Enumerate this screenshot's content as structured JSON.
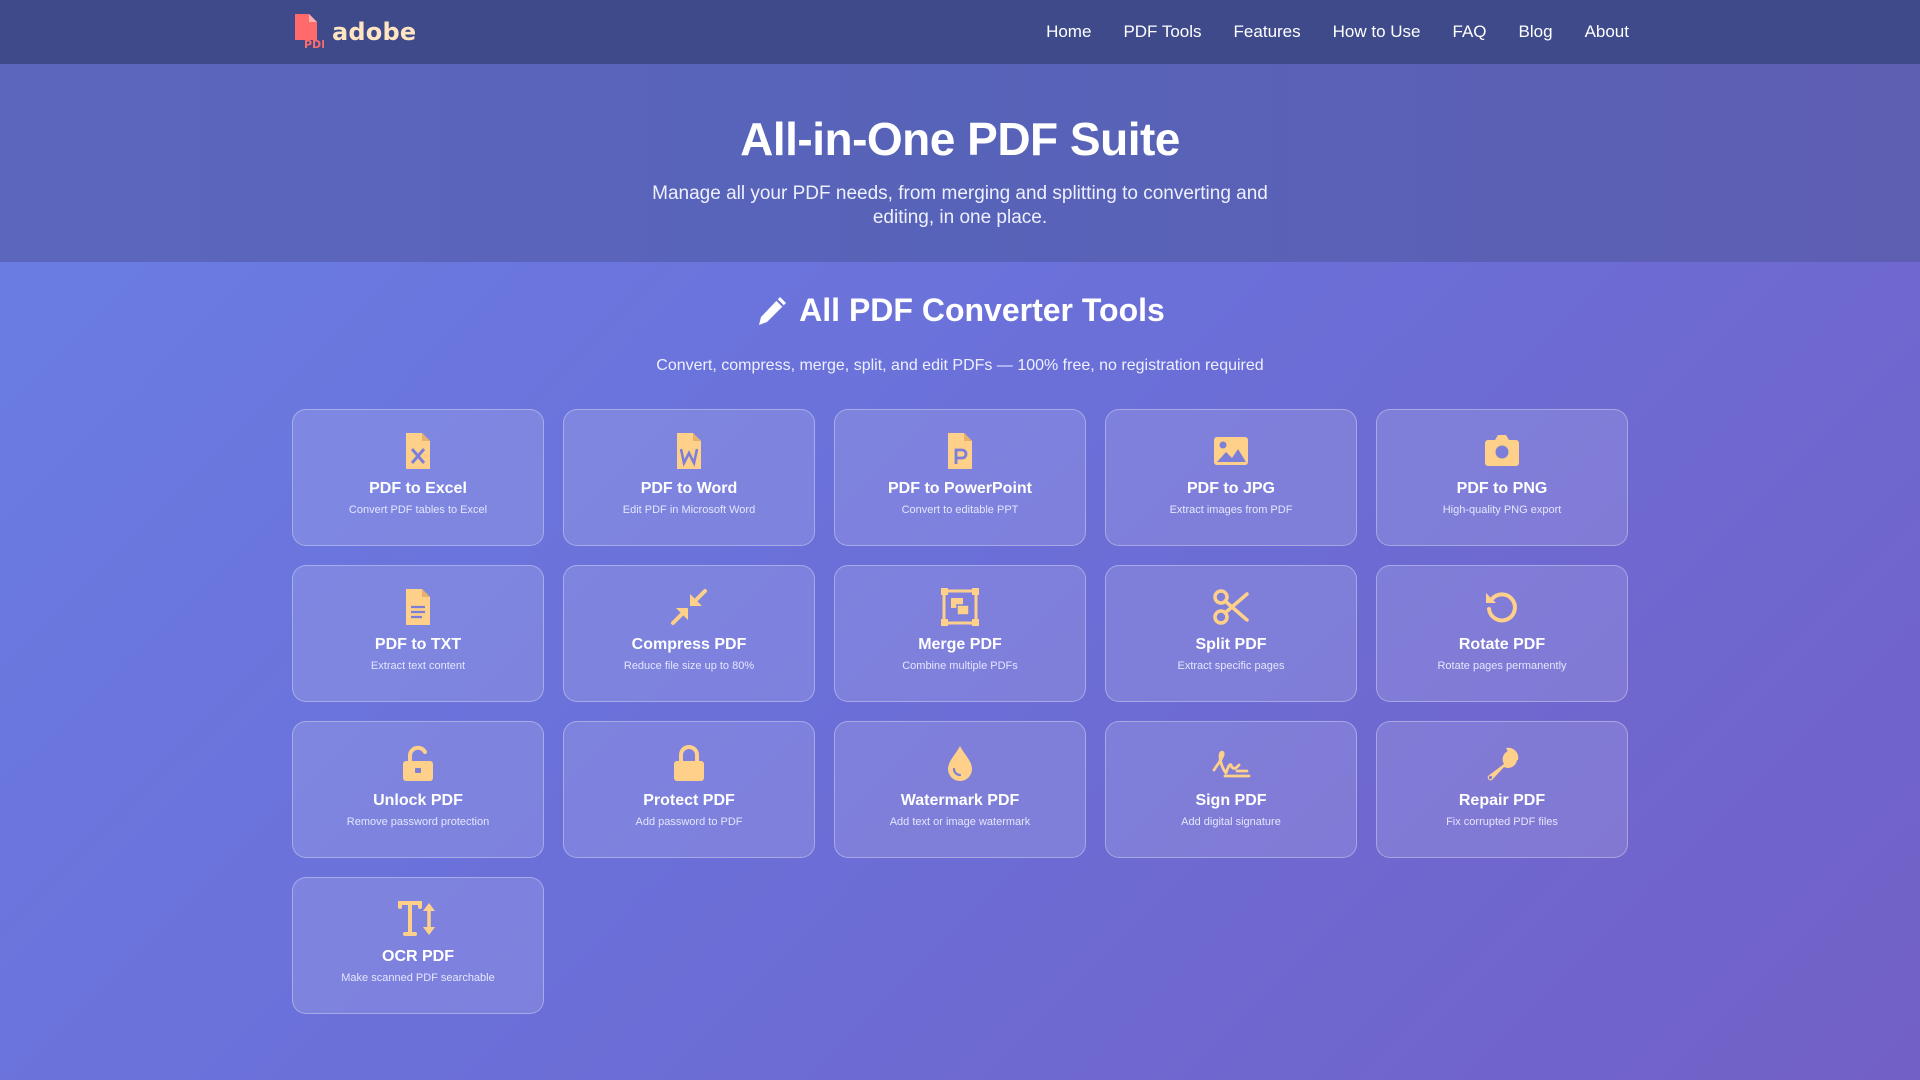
{
  "nav": {
    "brand": "adobe",
    "brand_badge": "PDF",
    "links": [
      "Home",
      "PDF Tools",
      "Features",
      "How to Use",
      "FAQ",
      "Blog",
      "About"
    ]
  },
  "hero": {
    "title": "All-in-One PDF Suite",
    "subtitle": "Manage all your PDF needs, from merging and splitting to converting and editing, in one place."
  },
  "section": {
    "title": "All PDF Converter Tools",
    "subtitle": "Convert, compress, merge, split, and edit PDFs — 100% free, no registration required"
  },
  "colors": {
    "accent_icon": "#ffd08a",
    "brand_red": "#ff6b6b",
    "brand_text": "#ffe5c2",
    "navbar": "#3e4a8a"
  },
  "tools": [
    {
      "title": "PDF to Excel",
      "desc": "Convert PDF tables to Excel",
      "icon": "file-excel-icon"
    },
    {
      "title": "PDF to Word",
      "desc": "Edit PDF in Microsoft Word",
      "icon": "file-word-icon"
    },
    {
      "title": "PDF to PowerPoint",
      "desc": "Convert to editable PPT",
      "icon": "file-powerpoint-icon"
    },
    {
      "title": "PDF to JPG",
      "desc": "Extract images from PDF",
      "icon": "image-icon"
    },
    {
      "title": "PDF to PNG",
      "desc": "High-quality PNG export",
      "icon": "camera-icon"
    },
    {
      "title": "PDF to TXT",
      "desc": "Extract text content",
      "icon": "file-text-icon"
    },
    {
      "title": "Compress PDF",
      "desc": "Reduce file size up to 80%",
      "icon": "compress-icon"
    },
    {
      "title": "Merge PDF",
      "desc": "Combine multiple PDFs",
      "icon": "object-group-icon"
    },
    {
      "title": "Split PDF",
      "desc": "Extract specific pages",
      "icon": "scissors-icon"
    },
    {
      "title": "Rotate PDF",
      "desc": "Rotate pages permanently",
      "icon": "rotate-icon"
    },
    {
      "title": "Unlock PDF",
      "desc": "Remove password protection",
      "icon": "unlock-icon"
    },
    {
      "title": "Protect PDF",
      "desc": "Add password to PDF",
      "icon": "lock-icon"
    },
    {
      "title": "Watermark PDF",
      "desc": "Add text or image watermark",
      "icon": "droplet-icon"
    },
    {
      "title": "Sign PDF",
      "desc": "Add digital signature",
      "icon": "signature-icon"
    },
    {
      "title": "Repair PDF",
      "desc": "Fix corrupted PDF files",
      "icon": "wrench-icon"
    },
    {
      "title": "OCR PDF",
      "desc": "Make scanned PDF searchable",
      "icon": "text-height-icon"
    }
  ]
}
